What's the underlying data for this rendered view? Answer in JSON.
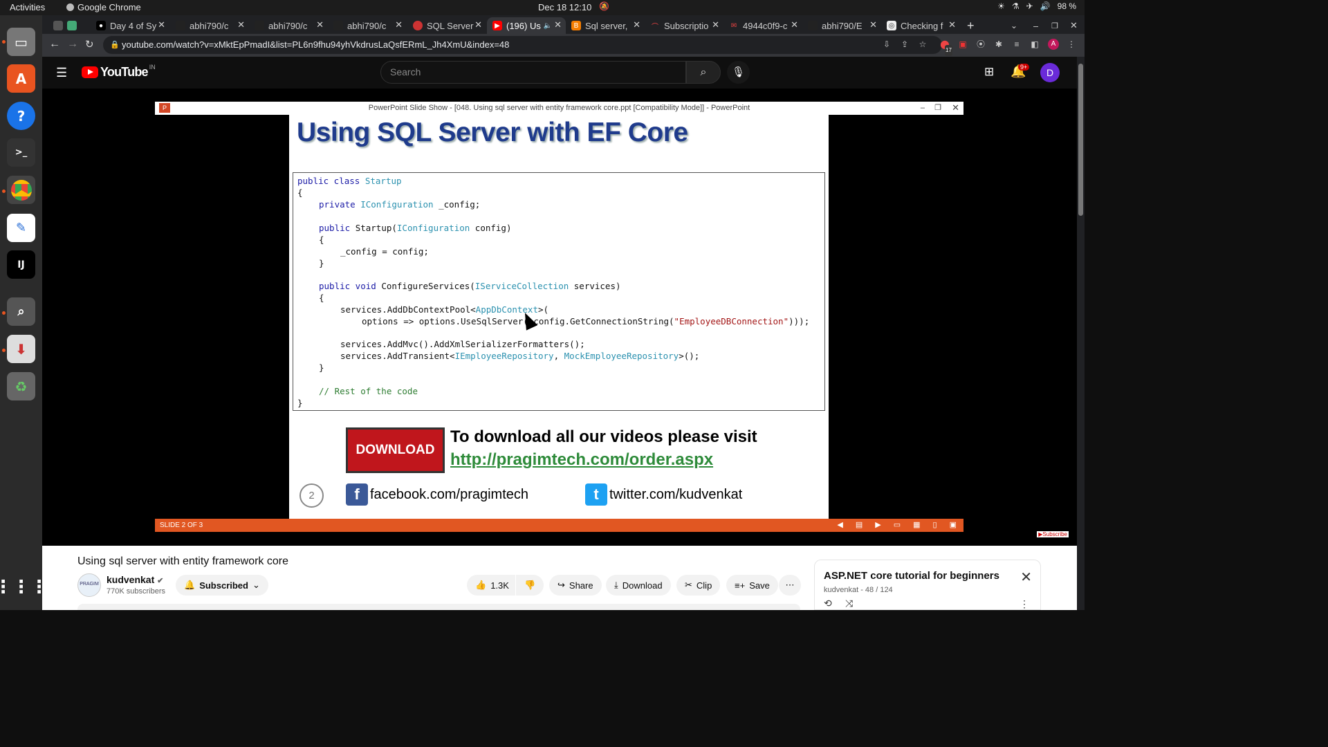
{
  "system": {
    "activities": "Activities",
    "app_name": "Google Chrome",
    "clock": "Dec 18  12:10",
    "battery": "98 %"
  },
  "tabs": [
    {
      "label": ""
    },
    {
      "label": "Day 4 of Sy"
    },
    {
      "label": "abhi790/c"
    },
    {
      "label": "abhi790/c"
    },
    {
      "label": "abhi790/c"
    },
    {
      "label": "SQL Server"
    },
    {
      "label": "(196) Us"
    },
    {
      "label": "Sql server,"
    },
    {
      "label": "Subscriptio"
    },
    {
      "label": "4944c0f9-c"
    },
    {
      "label": "abhi790/E"
    },
    {
      "label": "Checking f"
    }
  ],
  "address": {
    "url": "youtube.com/watch?v=xMktEpPmadI&list=PL6n9fhu94yhVkdrusLaQsfERmL_Jh4XmU&index=48"
  },
  "extensions_badge": "17",
  "youtube": {
    "logo_text": "YouTube",
    "logo_country": "IN",
    "search_placeholder": "Search",
    "notif_badge": "9+",
    "avatar_letter": "D"
  },
  "ppt": {
    "window_title": "PowerPoint Slide Show - [048. Using sql server with entity framework core.ppt [Compatibility Mode]] - PowerPoint",
    "slide_title": "Using SQL Server with EF Core",
    "download_button": "DOWNLOAD",
    "download_text": "To download all our videos please visit",
    "download_link": "http://pragimtech.com/order.aspx",
    "slide_number": "2",
    "facebook": "facebook.com/pragimtech",
    "twitter": "twitter.com/kudvenkat",
    "status": "SLIDE 2 OF 3",
    "code": {
      "l1_kw": "public class ",
      "l1_ty": "Startup",
      "l2": "{",
      "l3_kw": "private ",
      "l3_ty": "IConfiguration",
      "l3_rest": " _config;",
      "l4_kw": "public ",
      "l4_a": "Startup(",
      "l4_ty": "IConfiguration",
      "l4_b": " config)",
      "l5": "{",
      "l6": "_config = config;",
      "l7": "}",
      "l8_kw": "public void ",
      "l8_a": "ConfigureServices(",
      "l8_ty": "IServiceCollection",
      "l8_b": " services)",
      "l9": "{",
      "l10_a": "services.AddDbContextPool<",
      "l10_ty": "AppDbContext",
      "l10_b": ">(",
      "l11_a": "options => options.UseSqlServer(_config.GetConnectionString(",
      "l11_st": "\"EmployeeDBConnection\"",
      "l11_b": ")));",
      "l12": "services.AddMvc().AddXmlSerializerFormatters();",
      "l13_a": "services.AddTransient<",
      "l13_ty1": "IEmployeeRepository",
      "l13_c": ", ",
      "l13_ty2": "MockEmployeeRepository",
      "l13_b": ">();",
      "l14": "}",
      "l15": "// Rest of the code",
      "l16": "}"
    }
  },
  "video": {
    "title": "Using sql server with entity framework core",
    "channel": "kudvenkat",
    "subscribers": "770K subscribers",
    "subscribed": "Subscribed",
    "likes": "1.3K",
    "share": "Share",
    "download": "Download",
    "clip": "Clip",
    "save": "Save"
  },
  "playlist": {
    "title": "ASP.NET core tutorial for beginners",
    "sub": "kudvenkat - 48 / 124"
  }
}
